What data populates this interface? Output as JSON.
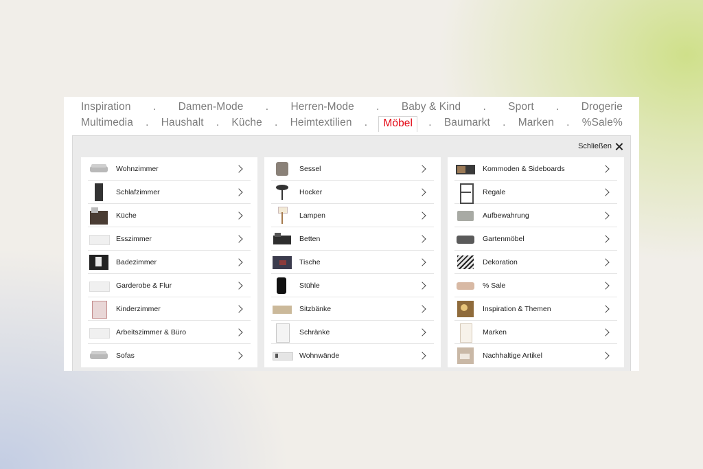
{
  "nav": {
    "row1": [
      "Inspiration",
      "Damen-Mode",
      "Herren-Mode",
      "Baby & Kind",
      "Sport",
      "Drogerie"
    ],
    "row2": [
      "Multimedia",
      "Haushalt",
      "Küche",
      "Heimtextilien",
      "Möbel",
      "Baumarkt",
      "Marken",
      "%Sale%"
    ],
    "separator": ".",
    "active": "Möbel",
    "active_color": "#e30613"
  },
  "flyout": {
    "close_label": "Schließen",
    "columns": [
      [
        {
          "label": "Wohnzimmer",
          "icon": "sofa-thumbnail"
        },
        {
          "label": "Schlafzimmer",
          "icon": "wardrobe-thumbnail"
        },
        {
          "label": "Küche",
          "icon": "kitchen-thumbnail"
        },
        {
          "label": "Esszimmer",
          "icon": "sideboard-thumbnail"
        },
        {
          "label": "Badezimmer",
          "icon": "bathroom-cabinet-thumbnail"
        },
        {
          "label": "Garderobe & Flur",
          "icon": "hallway-thumbnail"
        },
        {
          "label": "Kinderzimmer",
          "icon": "bunk-bed-thumbnail"
        },
        {
          "label": "Arbeitszimmer & Büro",
          "icon": "desk-thumbnail"
        },
        {
          "label": "Sofas",
          "icon": "sofa-thumbnail"
        }
      ],
      [
        {
          "label": "Sessel",
          "icon": "armchair-thumbnail"
        },
        {
          "label": "Hocker",
          "icon": "stool-thumbnail"
        },
        {
          "label": "Lampen",
          "icon": "floor-lamp-thumbnail"
        },
        {
          "label": "Betten",
          "icon": "bed-thumbnail"
        },
        {
          "label": "Tische",
          "icon": "table-thumbnail"
        },
        {
          "label": "Stühle",
          "icon": "office-chair-thumbnail"
        },
        {
          "label": "Sitzbänke",
          "icon": "bench-thumbnail"
        },
        {
          "label": "Schränke",
          "icon": "wardrobe-thumbnail"
        },
        {
          "label": "Wohnwände",
          "icon": "wall-unit-thumbnail"
        }
      ],
      [
        {
          "label": "Kommoden & Sideboards",
          "icon": "sideboard-thumbnail"
        },
        {
          "label": "Regale",
          "icon": "shelf-thumbnail"
        },
        {
          "label": "Aufbewahrung",
          "icon": "storage-box-thumbnail"
        },
        {
          "label": "Gartenmöbel",
          "icon": "garden-furniture-thumbnail"
        },
        {
          "label": "Dekoration",
          "icon": "decoration-thumbnail"
        },
        {
          "label": "% Sale",
          "icon": "sale-sofa-thumbnail"
        },
        {
          "label": "Inspiration & Themen",
          "icon": "inspiration-thumbnail"
        },
        {
          "label": "Marken",
          "icon": "brands-thumbnail"
        },
        {
          "label": "Nachhaltige Artikel",
          "icon": "sustainable-thumbnail"
        }
      ]
    ]
  }
}
